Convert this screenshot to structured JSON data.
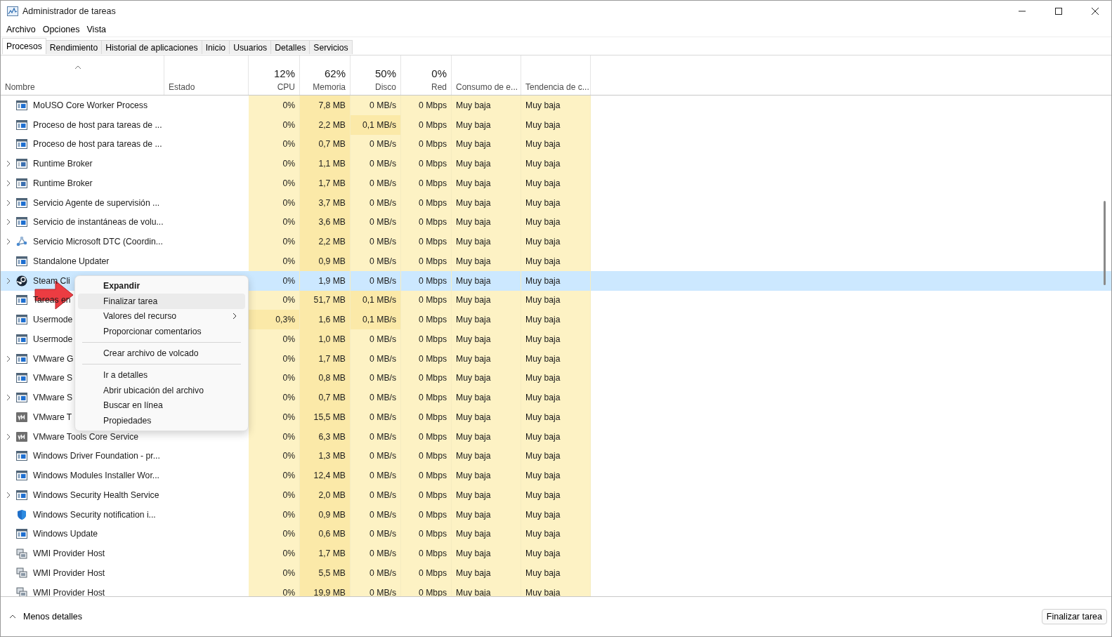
{
  "window": {
    "title": "Administrador de tareas"
  },
  "menu": [
    "Archivo",
    "Opciones",
    "Vista"
  ],
  "tabs": [
    {
      "label": "Procesos",
      "selected": true
    },
    {
      "label": "Rendimiento",
      "selected": false
    },
    {
      "label": "Historial de aplicaciones",
      "selected": false
    },
    {
      "label": "Inicio",
      "selected": false
    },
    {
      "label": "Usuarios",
      "selected": false
    },
    {
      "label": "Detalles",
      "selected": false
    },
    {
      "label": "Servicios",
      "selected": false
    }
  ],
  "columns": [
    {
      "label": "Nombre",
      "sorted": true
    },
    {
      "label": "Estado",
      "sorted": false
    },
    {
      "label": "CPU",
      "total": "12%",
      "sorted": false
    },
    {
      "label": "Memoria",
      "total": "62%",
      "sorted": false
    },
    {
      "label": "Disco",
      "total": "50%",
      "sorted": false
    },
    {
      "label": "Red",
      "total": "0%",
      "sorted": false
    },
    {
      "label": "Consumo de e...",
      "sorted": false
    },
    {
      "label": "Tendencia de c...",
      "sorted": false
    }
  ],
  "rows": [
    {
      "name": "MoUSO Core Worker Process",
      "kind": "app",
      "expandable": false,
      "selected": false,
      "values": [
        "0%",
        "7,8 MB",
        "0 MB/s",
        "0 Mbps",
        "Muy baja",
        "Muy baja"
      ],
      "hot": [
        false,
        true,
        false,
        false,
        false,
        false
      ]
    },
    {
      "name": "Proceso de host para tareas de ...",
      "kind": "app",
      "expandable": false,
      "selected": false,
      "values": [
        "0%",
        "2,2 MB",
        "0,1 MB/s",
        "0 Mbps",
        "Muy baja",
        "Muy baja"
      ],
      "hot": [
        false,
        true,
        true,
        false,
        false,
        false
      ]
    },
    {
      "name": "Proceso de host para tareas de ...",
      "kind": "app",
      "expandable": false,
      "selected": false,
      "values": [
        "0%",
        "0,7 MB",
        "0 MB/s",
        "0 Mbps",
        "Muy baja",
        "Muy baja"
      ],
      "hot": [
        false,
        true,
        false,
        false,
        false,
        false
      ]
    },
    {
      "name": "Runtime Broker",
      "kind": "runtime",
      "expandable": true,
      "selected": false,
      "values": [
        "0%",
        "1,1 MB",
        "0 MB/s",
        "0 Mbps",
        "Muy baja",
        "Muy baja"
      ],
      "hot": [
        false,
        true,
        false,
        false,
        false,
        false
      ]
    },
    {
      "name": "Runtime Broker",
      "kind": "runtime",
      "expandable": true,
      "selected": false,
      "values": [
        "0%",
        "1,7 MB",
        "0 MB/s",
        "0 Mbps",
        "Muy baja",
        "Muy baja"
      ],
      "hot": [
        false,
        true,
        false,
        false,
        false,
        false
      ]
    },
    {
      "name": "Servicio Agente de supervisión ...",
      "kind": "app",
      "expandable": true,
      "selected": false,
      "values": [
        "0%",
        "3,7 MB",
        "0 MB/s",
        "0 Mbps",
        "Muy baja",
        "Muy baja"
      ],
      "hot": [
        false,
        true,
        false,
        false,
        false,
        false
      ]
    },
    {
      "name": "Servicio de instantáneas de volu...",
      "kind": "app",
      "expandable": true,
      "selected": false,
      "values": [
        "0%",
        "3,6 MB",
        "0 MB/s",
        "0 Mbps",
        "Muy baja",
        "Muy baja"
      ],
      "hot": [
        false,
        true,
        false,
        false,
        false,
        false
      ]
    },
    {
      "name": "Servicio Microsoft DTC (Coordin...",
      "kind": "network",
      "expandable": true,
      "selected": false,
      "values": [
        "0%",
        "2,2 MB",
        "0 MB/s",
        "0 Mbps",
        "Muy baja",
        "Muy baja"
      ],
      "hot": [
        false,
        true,
        false,
        false,
        false,
        false
      ]
    },
    {
      "name": "Standalone Updater",
      "kind": "app",
      "expandable": false,
      "selected": false,
      "values": [
        "0%",
        "0,9 MB",
        "0 MB/s",
        "0 Mbps",
        "Muy baja",
        "Muy baja"
      ],
      "hot": [
        false,
        true,
        false,
        false,
        false,
        false
      ]
    },
    {
      "name": "Steam Cli",
      "kind": "steam",
      "expandable": true,
      "selected": true,
      "values": [
        "0%",
        "1,9 MB",
        "0 MB/s",
        "0 Mbps",
        "Muy baja",
        "Muy baja"
      ],
      "hot": [
        false,
        false,
        false,
        false,
        false,
        false
      ]
    },
    {
      "name": "Tareas en",
      "kind": "app",
      "expandable": false,
      "selected": false,
      "values": [
        "0%",
        "51,7 MB",
        "0,1 MB/s",
        "0 Mbps",
        "Muy baja",
        "Muy baja"
      ],
      "hot": [
        false,
        true,
        true,
        false,
        false,
        false
      ]
    },
    {
      "name": "Usermode",
      "kind": "app",
      "expandable": false,
      "selected": false,
      "values": [
        "0,3%",
        "1,6 MB",
        "0,1 MB/s",
        "0 Mbps",
        "Muy baja",
        "Muy baja"
      ],
      "hot": [
        true,
        true,
        true,
        false,
        false,
        false
      ]
    },
    {
      "name": "Usermode",
      "kind": "app",
      "expandable": false,
      "selected": false,
      "values": [
        "0%",
        "1,0 MB",
        "0 MB/s",
        "0 Mbps",
        "Muy baja",
        "Muy baja"
      ],
      "hot": [
        false,
        true,
        false,
        false,
        false,
        false
      ]
    },
    {
      "name": "VMware G",
      "kind": "app",
      "expandable": true,
      "selected": false,
      "values": [
        "0%",
        "1,7 MB",
        "0 MB/s",
        "0 Mbps",
        "Muy baja",
        "Muy baja"
      ],
      "hot": [
        false,
        true,
        false,
        false,
        false,
        false
      ]
    },
    {
      "name": "VMware S",
      "kind": "app",
      "expandable": false,
      "selected": false,
      "values": [
        "0%",
        "0,8 MB",
        "0 MB/s",
        "0 Mbps",
        "Muy baja",
        "Muy baja"
      ],
      "hot": [
        false,
        true,
        false,
        false,
        false,
        false
      ]
    },
    {
      "name": "VMware S",
      "kind": "app",
      "expandable": true,
      "selected": false,
      "values": [
        "0%",
        "0,7 MB",
        "0 MB/s",
        "0 Mbps",
        "Muy baja",
        "Muy baja"
      ],
      "hot": [
        false,
        true,
        false,
        false,
        false,
        false
      ]
    },
    {
      "name": "VMware T",
      "kind": "vm",
      "expandable": false,
      "selected": false,
      "values": [
        "0%",
        "15,5 MB",
        "0 MB/s",
        "0 Mbps",
        "Muy baja",
        "Muy baja"
      ],
      "hot": [
        false,
        true,
        false,
        false,
        false,
        false
      ]
    },
    {
      "name": "VMware Tools Core Service",
      "kind": "vm",
      "expandable": true,
      "selected": false,
      "values": [
        "0%",
        "6,3 MB",
        "0 MB/s",
        "0 Mbps",
        "Muy baja",
        "Muy baja"
      ],
      "hot": [
        false,
        true,
        false,
        false,
        false,
        false
      ]
    },
    {
      "name": "Windows Driver Foundation - pr...",
      "kind": "app",
      "expandable": false,
      "selected": false,
      "values": [
        "0%",
        "1,3 MB",
        "0 MB/s",
        "0 Mbps",
        "Muy baja",
        "Muy baja"
      ],
      "hot": [
        false,
        true,
        false,
        false,
        false,
        false
      ]
    },
    {
      "name": "Windows Modules Installer Wor...",
      "kind": "app",
      "expandable": false,
      "selected": false,
      "values": [
        "0%",
        "12,4 MB",
        "0 MB/s",
        "0 Mbps",
        "Muy baja",
        "Muy baja"
      ],
      "hot": [
        false,
        true,
        false,
        false,
        false,
        false
      ]
    },
    {
      "name": "Windows Security Health Service",
      "kind": "app",
      "expandable": true,
      "selected": false,
      "values": [
        "0%",
        "2,0 MB",
        "0 MB/s",
        "0 Mbps",
        "Muy baja",
        "Muy baja"
      ],
      "hot": [
        false,
        true,
        false,
        false,
        false,
        false
      ]
    },
    {
      "name": "Windows Security notification i...",
      "kind": "shield",
      "expandable": false,
      "selected": false,
      "values": [
        "0%",
        "0,9 MB",
        "0 MB/s",
        "0 Mbps",
        "Muy baja",
        "Muy baja"
      ],
      "hot": [
        false,
        true,
        false,
        false,
        false,
        false
      ]
    },
    {
      "name": "Windows Update",
      "kind": "app",
      "expandable": false,
      "selected": false,
      "values": [
        "0%",
        "0,6 MB",
        "0 MB/s",
        "0 Mbps",
        "Muy baja",
        "Muy baja"
      ],
      "hot": [
        false,
        true,
        false,
        false,
        false,
        false
      ]
    },
    {
      "name": "WMI Provider Host",
      "kind": "wmi",
      "expandable": false,
      "selected": false,
      "values": [
        "0%",
        "1,7 MB",
        "0 MB/s",
        "0 Mbps",
        "Muy baja",
        "Muy baja"
      ],
      "hot": [
        false,
        true,
        false,
        false,
        false,
        false
      ]
    },
    {
      "name": "WMI Provider Host",
      "kind": "wmi",
      "expandable": false,
      "selected": false,
      "values": [
        "0%",
        "5,5 MB",
        "0 MB/s",
        "0 Mbps",
        "Muy baja",
        "Muy baja"
      ],
      "hot": [
        false,
        true,
        false,
        false,
        false,
        false
      ]
    },
    {
      "name": "WMI Provider Host",
      "kind": "wmi",
      "expandable": false,
      "selected": false,
      "values": [
        "0%",
        "19,9 MB",
        "0 MB/s",
        "0 Mbps",
        "Muy baja",
        "Muy baja"
      ],
      "hot": [
        false,
        true,
        false,
        false,
        false,
        false
      ]
    }
  ],
  "context_menu": [
    {
      "kind": "item",
      "label": "Expandir",
      "default": true,
      "selected": false,
      "submenu": false
    },
    {
      "kind": "item",
      "label": "Finalizar tarea",
      "default": false,
      "selected": true,
      "submenu": false
    },
    {
      "kind": "item",
      "label": "Valores del recurso",
      "default": false,
      "selected": false,
      "submenu": true
    },
    {
      "kind": "item",
      "label": "Proporcionar comentarios",
      "default": false,
      "selected": false,
      "submenu": false
    },
    {
      "kind": "separator"
    },
    {
      "kind": "item",
      "label": "Crear archivo de volcado",
      "default": false,
      "selected": false,
      "submenu": false
    },
    {
      "kind": "separator"
    },
    {
      "kind": "item",
      "label": "Ir a detalles",
      "default": false,
      "selected": false,
      "submenu": false
    },
    {
      "kind": "item",
      "label": "Abrir ubicación del archivo",
      "default": false,
      "selected": false,
      "submenu": false
    },
    {
      "kind": "item",
      "label": "Buscar en línea",
      "default": false,
      "selected": false,
      "submenu": false
    },
    {
      "kind": "item",
      "label": "Propiedades",
      "default": false,
      "selected": false,
      "submenu": false
    }
  ],
  "footer": {
    "toggle": "Menos detalles",
    "button": "Finalizar tarea"
  }
}
